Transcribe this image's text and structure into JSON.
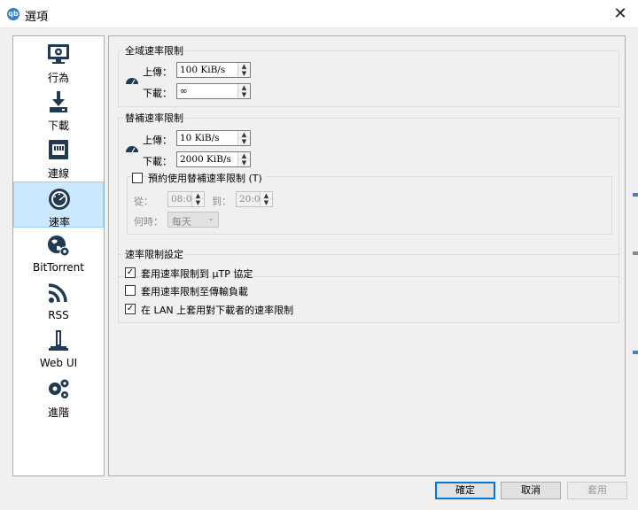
{
  "window": {
    "title": "選項",
    "app_icon": "qb"
  },
  "sidebar": {
    "items": [
      {
        "label": "行為",
        "icon": "monitor-gear-icon"
      },
      {
        "label": "下載",
        "icon": "download-icon"
      },
      {
        "label": "連線",
        "icon": "network-icon"
      },
      {
        "label": "速率",
        "icon": "speedometer-icon",
        "selected": true
      },
      {
        "label": "BitTorrent",
        "icon": "globe-gear-icon"
      },
      {
        "label": "RSS",
        "icon": "rss-icon"
      },
      {
        "label": "Web UI",
        "icon": "web-ui-icon"
      },
      {
        "label": "進階",
        "icon": "gears-icon"
      }
    ]
  },
  "global_limits": {
    "title": "全域速率限制",
    "upload_label": "上傳：",
    "upload_value": "100 KiB/s",
    "download_label": "下載：",
    "download_value": "∞"
  },
  "alt_limits": {
    "title": "替補速率限制",
    "upload_label": "上傳：",
    "upload_value": "10 KiB/s",
    "download_label": "下載：",
    "download_value": "2000 KiB/s",
    "schedule": {
      "label": "預約使用替補速率限制 (T)",
      "checked": false,
      "from_label": "從：",
      "from_value": "08:00",
      "to_label": "到：",
      "to_value": "20:00",
      "when_label": "何時：",
      "when_value": "每天"
    }
  },
  "limit_settings": {
    "title": "速率限制設定",
    "options": [
      {
        "label": "套用速率限制到 µTP 協定",
        "checked": true
      },
      {
        "label": "套用速率限制至傳輸負載",
        "checked": false
      },
      {
        "label": "在 LAN 上套用對下載者的速率限制",
        "checked": true
      }
    ]
  },
  "buttons": {
    "ok": "確定",
    "cancel": "取消",
    "apply": "套用"
  },
  "colors": {
    "accent": "#0078d7",
    "selected_bg": "#cce8ff",
    "icon_dark": "#1f3a52"
  }
}
